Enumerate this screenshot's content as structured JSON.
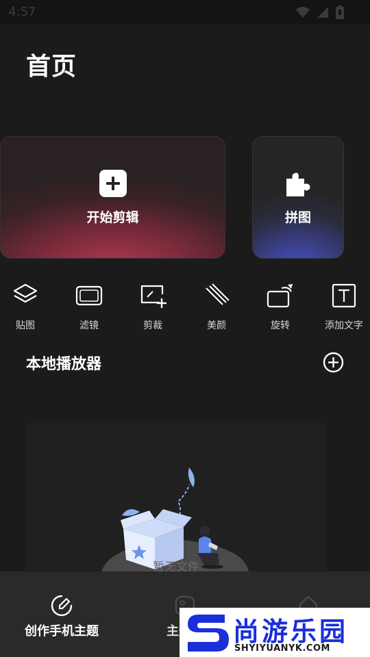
{
  "status_bar": {
    "time": "4:57",
    "icons": [
      "wifi-icon",
      "cell-signal-icon",
      "battery-icon"
    ]
  },
  "page": {
    "title": "首页"
  },
  "cards": {
    "edit": {
      "label": "开始剪辑",
      "icon": "plus-square-icon"
    },
    "puzzle": {
      "label": "拼图",
      "icon": "puzzle-icon"
    }
  },
  "tools": [
    {
      "label": "贴图",
      "icon": "layers-icon"
    },
    {
      "label": "滤镜",
      "icon": "filter-frame-icon"
    },
    {
      "label": "剪裁",
      "icon": "crop-icon"
    },
    {
      "label": "美颜",
      "icon": "beauty-lines-icon"
    },
    {
      "label": "旋转",
      "icon": "rotate-icon"
    },
    {
      "label": "添加文字",
      "icon": "text-icon"
    }
  ],
  "local_player": {
    "title": "本地播放器",
    "add_icon": "plus-circle-icon",
    "empty_text": "暂无文件"
  },
  "bottom_nav": [
    {
      "label": "创作手机主题",
      "icon": "pencil-circle-icon",
      "active": true
    },
    {
      "label": "主题壁",
      "icon": "image-icon",
      "active": false
    },
    {
      "label": "",
      "icon": "home-icon",
      "active": false
    }
  ],
  "watermark": {
    "title": "尚游乐园",
    "subtitle": "SHYIYUANYK.COM"
  },
  "colors": {
    "background": "#1b1b1b",
    "nav_background": "#2a2a2a",
    "edit_card_accent": "#b13a54",
    "puzzle_card_accent": "#4656d8",
    "watermark_blue": "#1a2fd8"
  }
}
